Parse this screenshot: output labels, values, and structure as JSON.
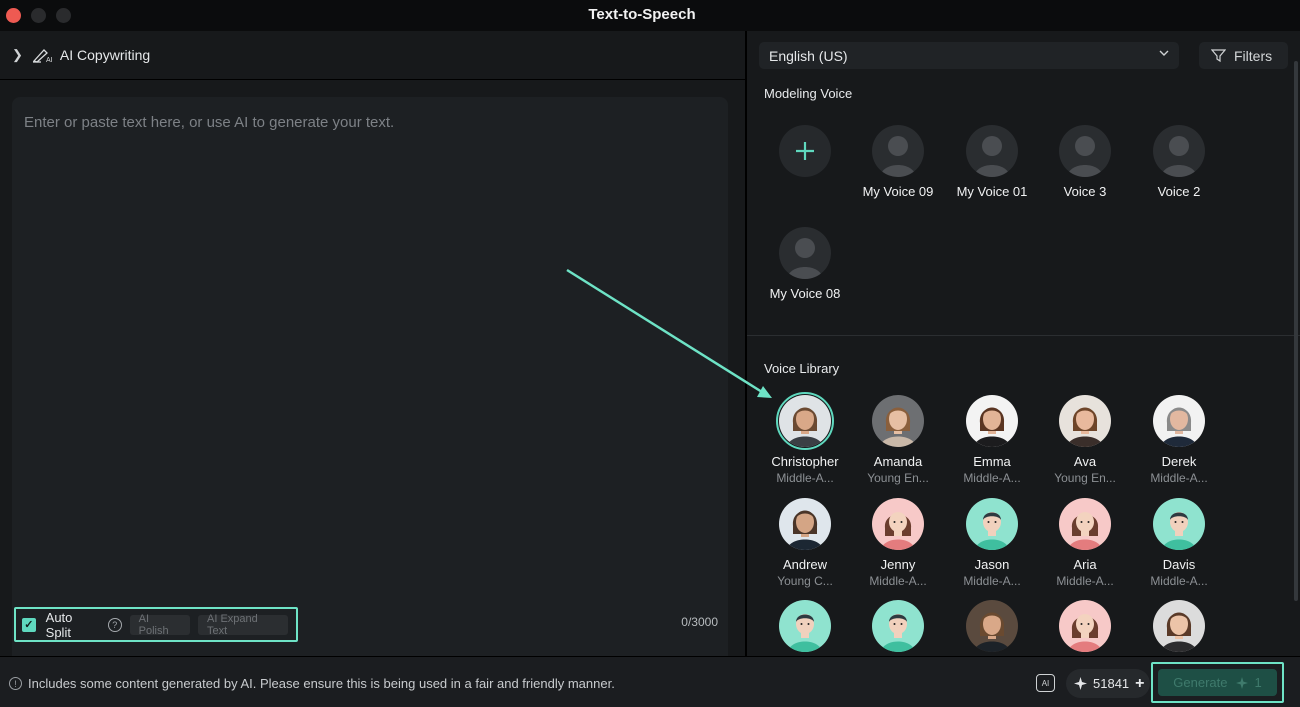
{
  "window": {
    "title": "Text-to-Speech"
  },
  "editor": {
    "ai_copywriting_label": "AI Copywriting",
    "placeholder": "Enter or paste text here, or use AI to generate your text.",
    "auto_split_label": "Auto Split",
    "auto_split_checked": true,
    "ai_polish_label": "AI Polish",
    "ai_expand_label": "AI Expand Text",
    "char_counter": "0/3000"
  },
  "voices_panel": {
    "language": "English (US)",
    "filters_label": "Filters",
    "modeling_title": "Modeling Voice",
    "library_title": "Voice Library",
    "modeling_voices": [
      {
        "name": "My Voice 09"
      },
      {
        "name": "My Voice 01"
      },
      {
        "name": "Voice 3"
      },
      {
        "name": "Voice 2"
      },
      {
        "name": "My Voice 08"
      }
    ],
    "library_voices": [
      {
        "name": "Christopher",
        "desc": "Middle-A...",
        "selected": true
      },
      {
        "name": "Amanda",
        "desc": "Young En..."
      },
      {
        "name": "Emma",
        "desc": "Middle-A..."
      },
      {
        "name": "Ava",
        "desc": "Young En..."
      },
      {
        "name": "Derek",
        "desc": "Middle-A..."
      },
      {
        "name": "Andrew",
        "desc": "Young C..."
      },
      {
        "name": "Jenny",
        "desc": "Middle-A..."
      },
      {
        "name": "Jason",
        "desc": "Middle-A..."
      },
      {
        "name": "Aria",
        "desc": "Middle-A..."
      },
      {
        "name": "Davis",
        "desc": "Middle-A..."
      }
    ]
  },
  "footer": {
    "notice": "Includes some content generated by AI. Please ensure this is being used in a fair and friendly manner.",
    "credits": "51841",
    "generate_label": "Generate",
    "generate_cost": "1"
  },
  "colors": {
    "accent": "#5fd8be",
    "annotation": "#6ee3c6",
    "background": "#17191b"
  }
}
